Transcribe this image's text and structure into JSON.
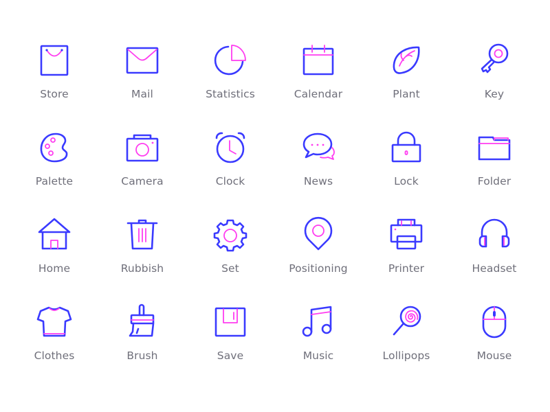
{
  "colors": {
    "primary": "#3a3aff",
    "accent": "#ff3df0",
    "label": "#6f6f7a",
    "background": "#ffffff"
  },
  "icons": [
    {
      "label": "Store",
      "icon": "shopping-bag-icon"
    },
    {
      "label": "Mail",
      "icon": "mail-icon"
    },
    {
      "label": "Statistics",
      "icon": "pie-chart-icon"
    },
    {
      "label": "Calendar",
      "icon": "calendar-icon"
    },
    {
      "label": "Plant",
      "icon": "leaf-icon"
    },
    {
      "label": "Key",
      "icon": "key-icon"
    },
    {
      "label": "Palette",
      "icon": "palette-icon"
    },
    {
      "label": "Camera",
      "icon": "camera-icon"
    },
    {
      "label": "Clock",
      "icon": "alarm-clock-icon"
    },
    {
      "label": "News",
      "icon": "chat-bubbles-icon"
    },
    {
      "label": "Lock",
      "icon": "lock-icon"
    },
    {
      "label": "Folder",
      "icon": "folder-icon"
    },
    {
      "label": "Home",
      "icon": "house-icon"
    },
    {
      "label": "Rubbish",
      "icon": "trash-can-icon"
    },
    {
      "label": "Set",
      "icon": "gear-icon"
    },
    {
      "label": "Positioning",
      "icon": "map-pin-icon"
    },
    {
      "label": "Printer",
      "icon": "printer-icon"
    },
    {
      "label": "Headset",
      "icon": "headphones-icon"
    },
    {
      "label": "Clothes",
      "icon": "t-shirt-icon"
    },
    {
      "label": "Brush",
      "icon": "paint-brush-icon"
    },
    {
      "label": "Save",
      "icon": "floppy-disk-icon"
    },
    {
      "label": "Music",
      "icon": "music-note-icon"
    },
    {
      "label": "Lollipops",
      "icon": "lollipop-icon"
    },
    {
      "label": "Mouse",
      "icon": "computer-mouse-icon"
    }
  ]
}
